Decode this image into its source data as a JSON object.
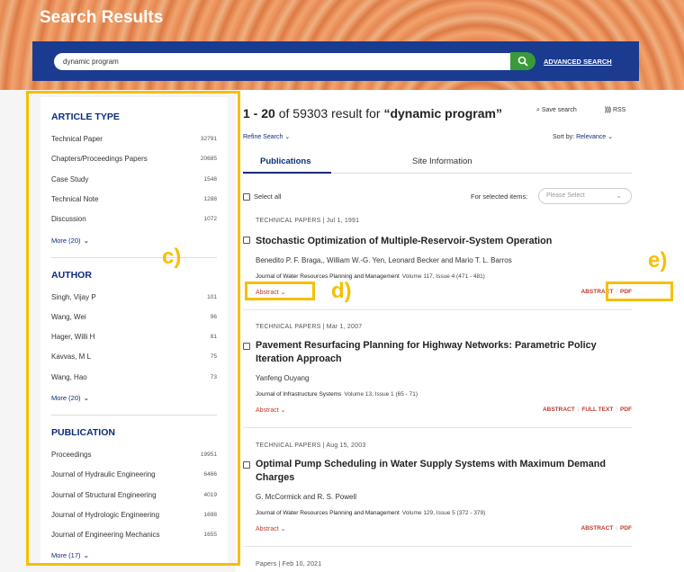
{
  "header": {
    "title": "Search Results",
    "search_value": "dynamic program",
    "advanced_search": "ADVANCED SEARCH"
  },
  "sidebar": {
    "article_type": {
      "title": "ARTICLE TYPE",
      "items": [
        {
          "label": "Technical Paper",
          "count": "32791"
        },
        {
          "label": "Chapters/Proceedings Papers",
          "count": "20685"
        },
        {
          "label": "Case Study",
          "count": "1548"
        },
        {
          "label": "Technical Note",
          "count": "1288"
        },
        {
          "label": "Discussion",
          "count": "1072"
        }
      ],
      "more": "More (20)"
    },
    "author": {
      "title": "AUTHOR",
      "items": [
        {
          "label": "Singh, Vijay P",
          "count": "101"
        },
        {
          "label": "Wang, Wei",
          "count": "96"
        },
        {
          "label": "Hager, Willi H",
          "count": "81"
        },
        {
          "label": "Kavvas, M L",
          "count": "75"
        },
        {
          "label": "Wang, Hao",
          "count": "73"
        }
      ],
      "more": "More (20)"
    },
    "publication": {
      "title": "PUBLICATION",
      "items": [
        {
          "label": "Proceedings",
          "count": "19951"
        },
        {
          "label": "Journal of Hydraulic Engineering",
          "count": "6466"
        },
        {
          "label": "Journal of Structural Engineering",
          "count": "4019"
        },
        {
          "label": "Journal of Hydrologic Engineering",
          "count": "1698"
        },
        {
          "label": "Journal of Engineering Mechanics",
          "count": "1655"
        }
      ],
      "more": "More (17)"
    }
  },
  "main": {
    "range": "1 - 20",
    "of": "of",
    "total": "59303",
    "result_for": "result for",
    "query": "“dynamic program”",
    "save_search": "Save search",
    "rss": "RSS",
    "refine": "Refine Search",
    "sort_label": "Sort by:",
    "sort_value": "Relevance",
    "tabs": [
      "Publications",
      "Site Information"
    ],
    "select_all": "Select all",
    "for_selected": "For selected items:",
    "please_select": "Please Select"
  },
  "results": [
    {
      "meta": "TECHNICAL PAPERS  |  Jul 1, 1991",
      "title": "Stochastic Optimization of Multiple-Reservoir-System Operation",
      "authors": "Benedito P. F. Braga,, William W.-G. Yen, Leonard Becker and Mario T. L. Barros",
      "journal": "Journal of Water Resources Planning and Management",
      "volume": "Volume 117, Issue 4 (471 - 481)",
      "abstract": "Abstract",
      "links": [
        "ABSTRACT",
        "PDF"
      ]
    },
    {
      "meta": "TECHNICAL PAPERS  |  Mar 1, 2007",
      "title": "Pavement Resurfacing Planning for Highway Networks: Parametric Policy Iteration Approach",
      "authors": "Yanfeng Ouyang",
      "journal": "Journal of Infrastructure Systems",
      "volume": "Volume 13, Issue 1 (65 - 71)",
      "abstract": "Abstract",
      "links": [
        "ABSTRACT",
        "FULL TEXT",
        "PDF"
      ]
    },
    {
      "meta": "TECHNICAL PAPERS  |  Aug 15, 2003",
      "title": "Optimal Pump Scheduling in Water Supply Systems with Maximum Demand Charges",
      "authors": "G. McCormick and R. S. Powell",
      "journal": "Journal of Water Resources Planning and Management",
      "volume": "Volume 129, Issue 5 (372 - 379)",
      "abstract": "Abstract",
      "links": [
        "ABSTRACT",
        "PDF"
      ]
    },
    {
      "meta": "Papers  |  Feb 10, 2021"
    }
  ],
  "annotations": {
    "c": "c)",
    "d": "d)",
    "e": "e)",
    "color": "#f5c000"
  }
}
